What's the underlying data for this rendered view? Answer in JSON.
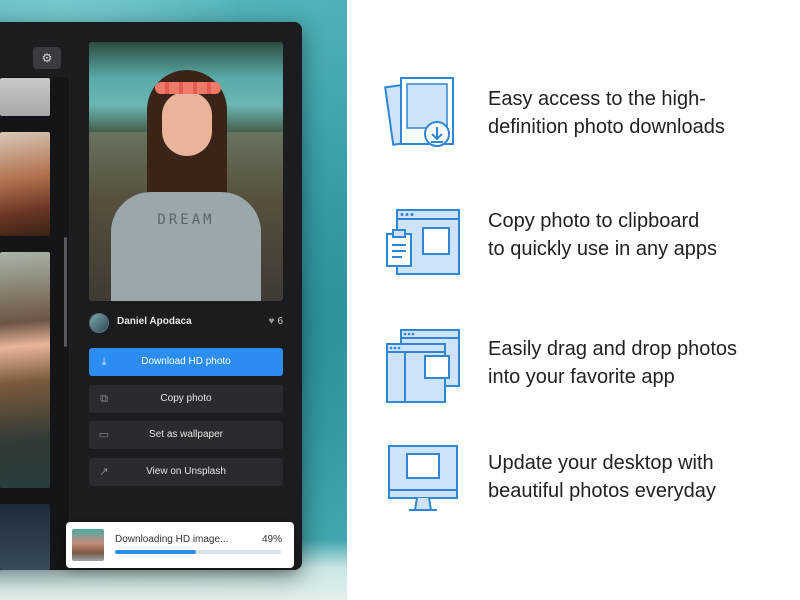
{
  "colors": {
    "accent": "#2b8df2",
    "icon_stroke": "#2f86d6",
    "icon_fill": "#cfe3f8",
    "panel_bg": "#1b1c1f",
    "text_dark": "#222222"
  },
  "app": {
    "toolbar": {
      "layout_icon": "layout-icon",
      "settings_icon": "gear-icon"
    },
    "photo": {
      "caption_text": "DREAM",
      "author": "Daniel Apodaca",
      "likes": "6",
      "likes_icon": "heart-icon"
    },
    "actions": [
      {
        "label": "Download HD photo",
        "icon": "download-icon"
      },
      {
        "label": "Copy photo",
        "icon": "copy-icon"
      },
      {
        "label": "Set as wallpaper",
        "icon": "monitor-icon"
      },
      {
        "label": "View on Unsplash",
        "icon": "external-link-icon"
      }
    ]
  },
  "download": {
    "label": "Downloading HD image...",
    "percent_text": "49%",
    "progress": 0.49
  },
  "features": [
    {
      "icon": "photo-download-icon",
      "lines": [
        "Easy access to the high-",
        "definition photo downloads"
      ]
    },
    {
      "icon": "clipboard-window-icon",
      "lines": [
        "Copy photo to clipboard",
        "to quickly use in any apps"
      ]
    },
    {
      "icon": "drag-drop-windows-icon",
      "lines": [
        "Easily drag and drop photos",
        "into your favorite app"
      ]
    },
    {
      "icon": "desktop-monitor-icon",
      "lines": [
        "Update your desktop with",
        "beautiful photos everyday"
      ]
    }
  ]
}
